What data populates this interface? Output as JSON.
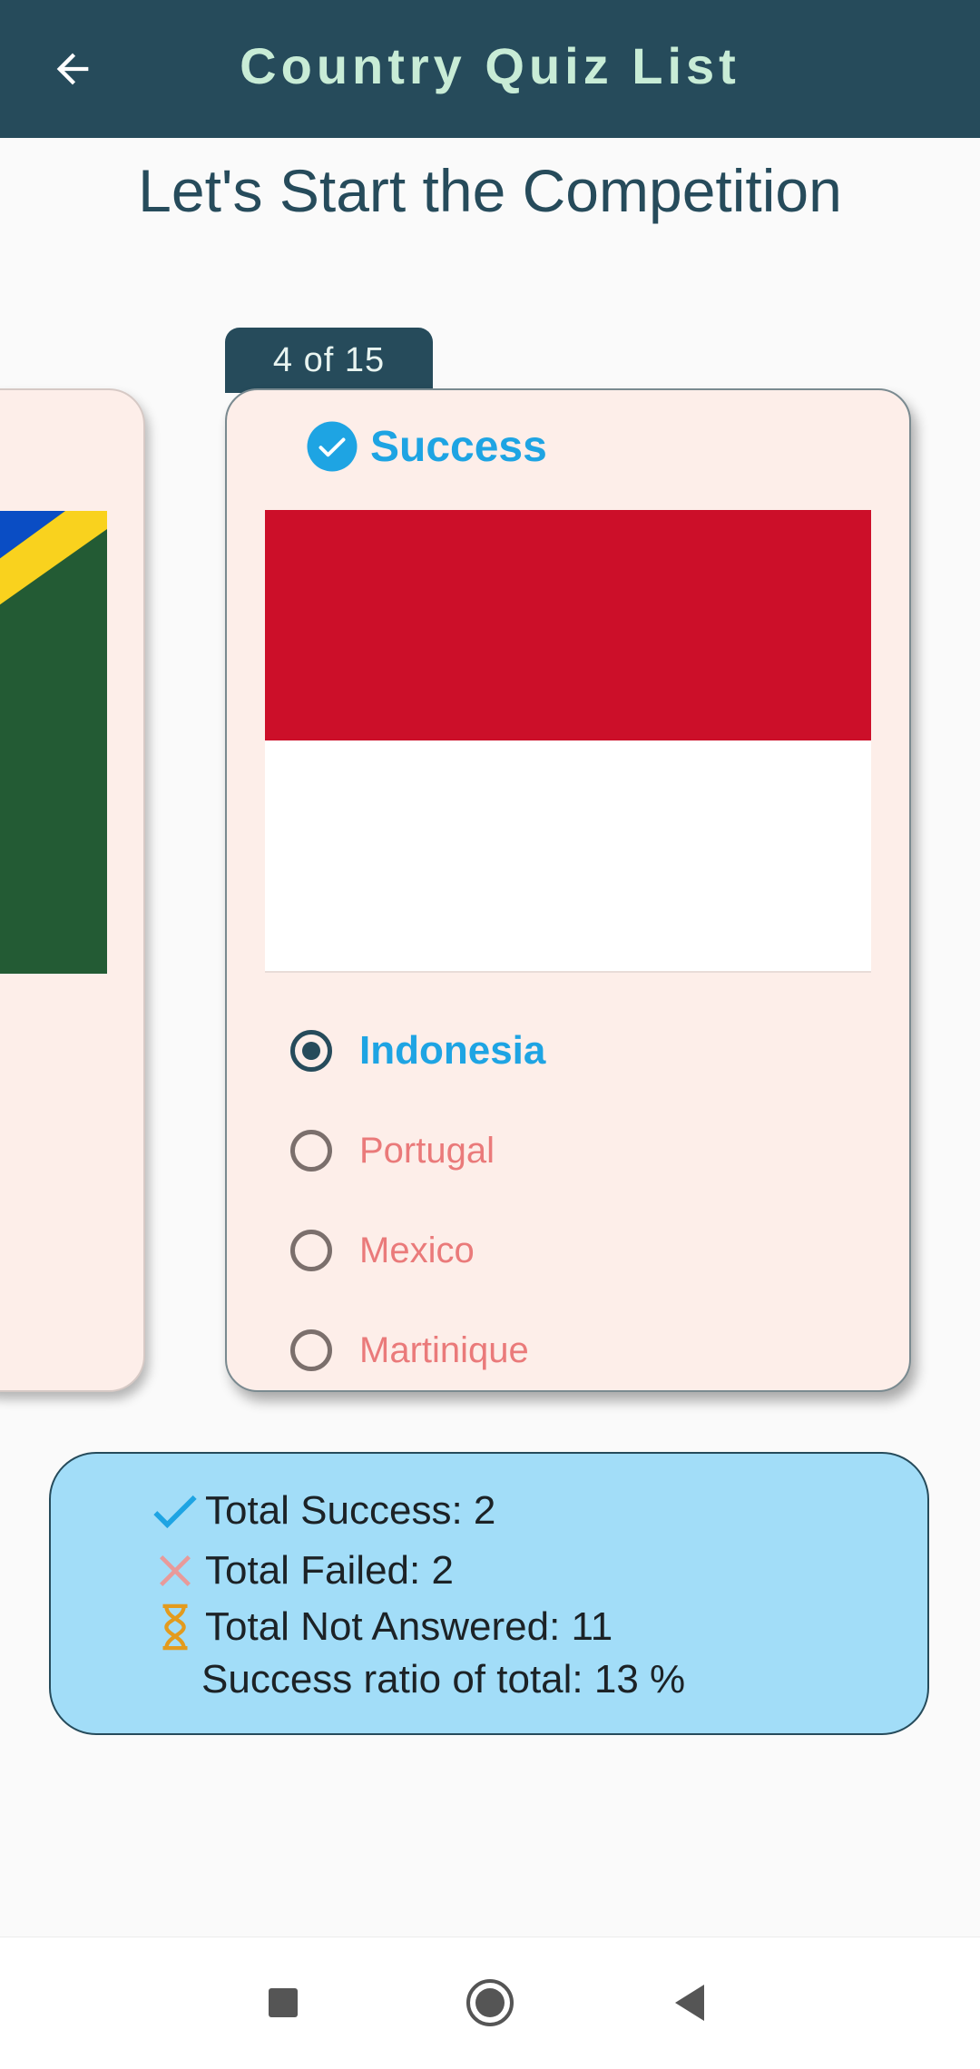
{
  "appbar": {
    "title": "Country Quiz List",
    "back_icon": "arrow-left-icon"
  },
  "heading": "Let's Start the Competition",
  "card": {
    "counter": "4  of  15",
    "status": {
      "label": "Success",
      "icon": "check-circle-icon",
      "color": "#1ea4e3"
    },
    "flag": {
      "country_shown": "Indonesia",
      "colors": [
        "#cc0f29",
        "#ffffff"
      ]
    },
    "options": [
      {
        "label": "Indonesia",
        "selected": true,
        "correct": true
      },
      {
        "label": "Portugal",
        "selected": false
      },
      {
        "label": "Mexico",
        "selected": false
      },
      {
        "label": "Martinique",
        "selected": false
      }
    ]
  },
  "previous_card": {
    "flag_colors": [
      "#0a4dc4",
      "#f9d21e",
      "#235b34"
    ]
  },
  "summary": {
    "total_success": "Total Success: 2",
    "total_failed": "Total Failed: 2",
    "total_not_answered": "Total Not Answered: 11",
    "success_ratio": "Success ratio of total: 13 %",
    "background": "#a2ddf8"
  },
  "navbar": {
    "items": [
      "recents-square-icon",
      "home-circle-icon",
      "back-triangle-icon"
    ]
  }
}
